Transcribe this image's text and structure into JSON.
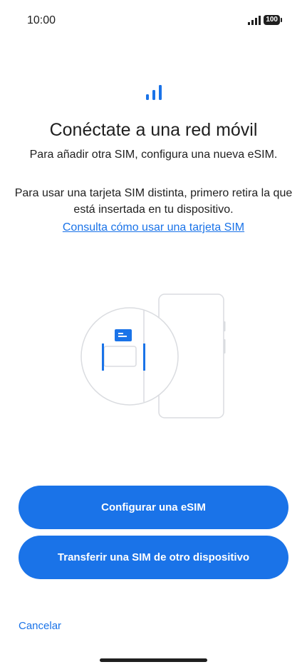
{
  "status_bar": {
    "time": "10:00",
    "battery": "100",
    "signal_icon": "signal-bars-icon"
  },
  "header": {
    "icon": "cellular-signal-icon",
    "title": "Conéctate a una red móvil",
    "subtitle": "Para añadir otra SIM, configura una nueva eSIM."
  },
  "body": {
    "text": "Para usar una tarjeta SIM distinta, primero retira la que está insertada en tu dispositivo.",
    "link": "Consulta cómo usar una tarjeta SIM"
  },
  "illustration": {
    "icon": "sim-tray-illustration"
  },
  "actions": {
    "primary": "Configurar una eSIM",
    "secondary": "Transferir una SIM de otro dispositivo",
    "cancel": "Cancelar"
  },
  "colors": {
    "accent": "#1a73e8",
    "text": "#1f1f1f",
    "background": "#ffffff",
    "illustration_stroke": "#dadce0"
  }
}
